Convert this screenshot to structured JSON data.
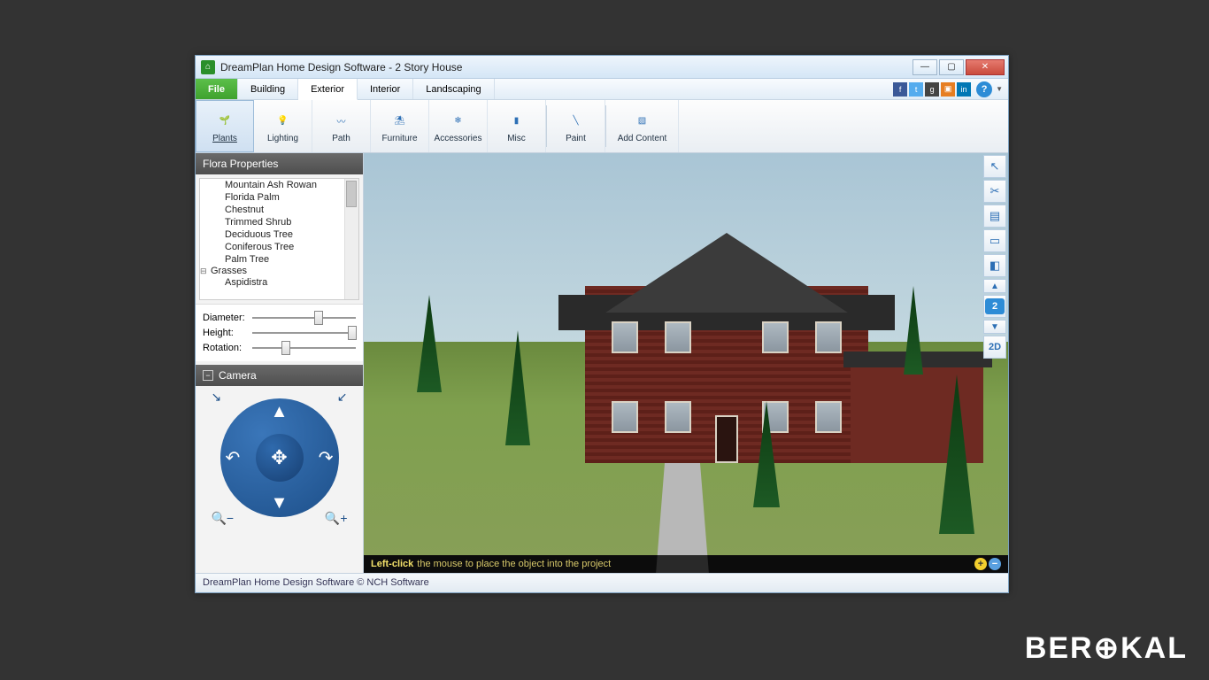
{
  "window": {
    "title": "DreamPlan Home Design Software - 2 Story House",
    "app_icon_glyph": "⌂"
  },
  "menu": {
    "file": "File",
    "tabs": [
      "Building",
      "Exterior",
      "Interior",
      "Landscaping"
    ],
    "active": "Exterior"
  },
  "social": {
    "facebook": "f",
    "twitter": "t",
    "google": "g",
    "share": "▣",
    "linkedin": "in"
  },
  "toolbar": [
    {
      "label": "Plants",
      "icon": "🌱",
      "active": true
    },
    {
      "label": "Lighting",
      "icon": "💡"
    },
    {
      "label": "Path",
      "icon": "〰"
    },
    {
      "label": "Furniture",
      "icon": "⛱"
    },
    {
      "label": "Accessories",
      "icon": "❄"
    },
    {
      "label": "Misc",
      "icon": "▮"
    },
    {
      "divider": true
    },
    {
      "label": "Paint",
      "icon": "╲"
    },
    {
      "divider": true
    },
    {
      "label": "Add Content",
      "icon": "▧"
    }
  ],
  "flora_panel": {
    "title": "Flora Properties",
    "tree_items": [
      "Mountain Ash Rowan",
      "Florida Palm",
      "Chestnut",
      "Trimmed Shrub",
      "Deciduous Tree",
      "Coniferous Tree",
      "Palm Tree"
    ],
    "category": "Grasses",
    "sub_item": "Aspidistra",
    "sliders": {
      "diameter": {
        "label": "Diameter:",
        "pos": 60
      },
      "height": {
        "label": "Height:",
        "pos": 92
      },
      "rotation": {
        "label": "Rotation:",
        "pos": 28
      }
    }
  },
  "camera_panel": {
    "title": "Camera"
  },
  "right_tools": {
    "cursor": "↖",
    "cut": "✂",
    "page": "▤",
    "tile": "▭",
    "cube": "◧",
    "up": "▲",
    "floor": "2",
    "down": "▼",
    "mode": "2D"
  },
  "hint": {
    "bold": "Left-click",
    "rest": "the mouse to place the object into the project"
  },
  "statusbar": "DreamPlan Home Design Software © NCH Software",
  "watermark": "BER🧠KAL"
}
